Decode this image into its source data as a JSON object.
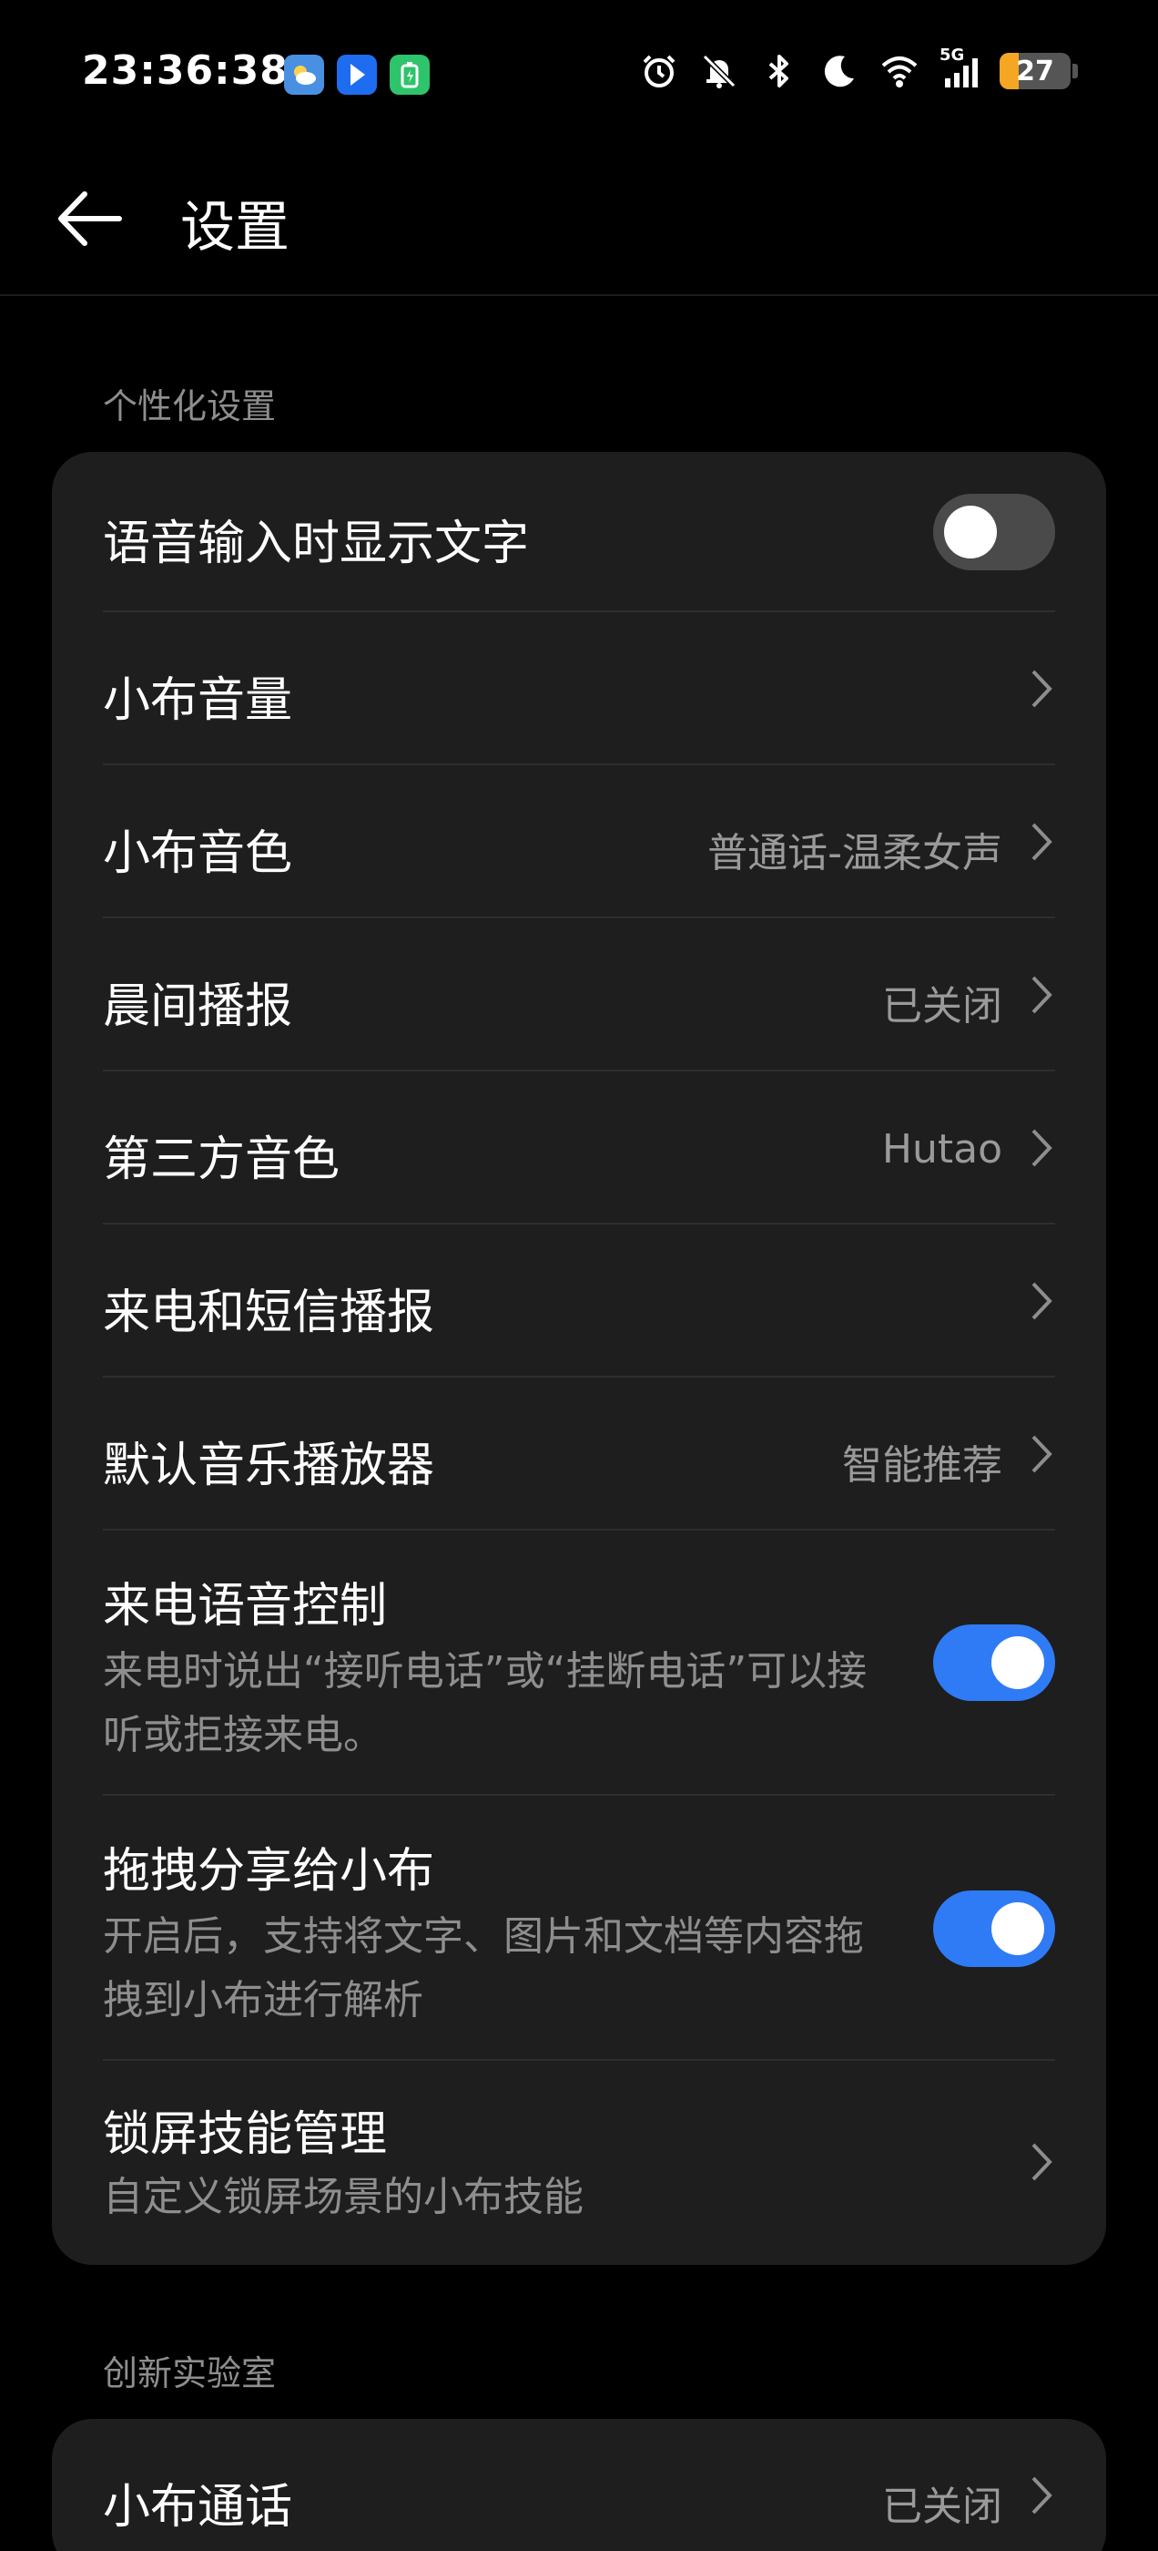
{
  "status_bar": {
    "time": "23:36:38",
    "battery_level": "27",
    "network": "5G",
    "battery_color": "#f5a623",
    "notification_icons": [
      "weather-icon",
      "app-icon",
      "battery-saver-icon"
    ],
    "system_icons": [
      "alarm-icon",
      "mute-icon",
      "bluetooth-icon",
      "do-not-disturb-icon",
      "wifi-icon",
      "cellular-icon",
      "battery-icon"
    ]
  },
  "header": {
    "title": "设置"
  },
  "sections": {
    "personalization": {
      "label": "个性化设置",
      "items": [
        {
          "title": "语音输入时显示文字",
          "type": "toggle",
          "on": false
        },
        {
          "title": "小布音量",
          "type": "link"
        },
        {
          "title": "小布音色",
          "type": "link",
          "value": "普通话-温柔女声"
        },
        {
          "title": "晨间播报",
          "type": "link",
          "value": "已关闭"
        },
        {
          "title": "第三方音色",
          "type": "link",
          "value": "Hutao"
        },
        {
          "title": "来电和短信播报",
          "type": "link"
        },
        {
          "title": "默认音乐播放器",
          "type": "link",
          "value": "智能推荐"
        },
        {
          "title": "来电语音控制",
          "type": "toggle",
          "on": true,
          "subtitle": "来电时说出“接听电话”或“挂断电话”可以接听或拒接来电。"
        },
        {
          "title": "拖拽分享给小布",
          "type": "toggle",
          "on": true,
          "subtitle": "开启后，支持将文字、图片和文档等内容拖拽到小布进行解析"
        },
        {
          "title": "锁屏技能管理",
          "type": "link",
          "subtitle": "自定义锁屏场景的小布技能"
        }
      ]
    },
    "lab": {
      "label": "创新实验室",
      "items": [
        {
          "title": "小布通话",
          "type": "link",
          "value": "已关闭"
        }
      ]
    }
  },
  "colors": {
    "toggle_on": "#2f7bf5",
    "toggle_off": "#4a4a4a",
    "card_bg": "#1e1e1e"
  }
}
